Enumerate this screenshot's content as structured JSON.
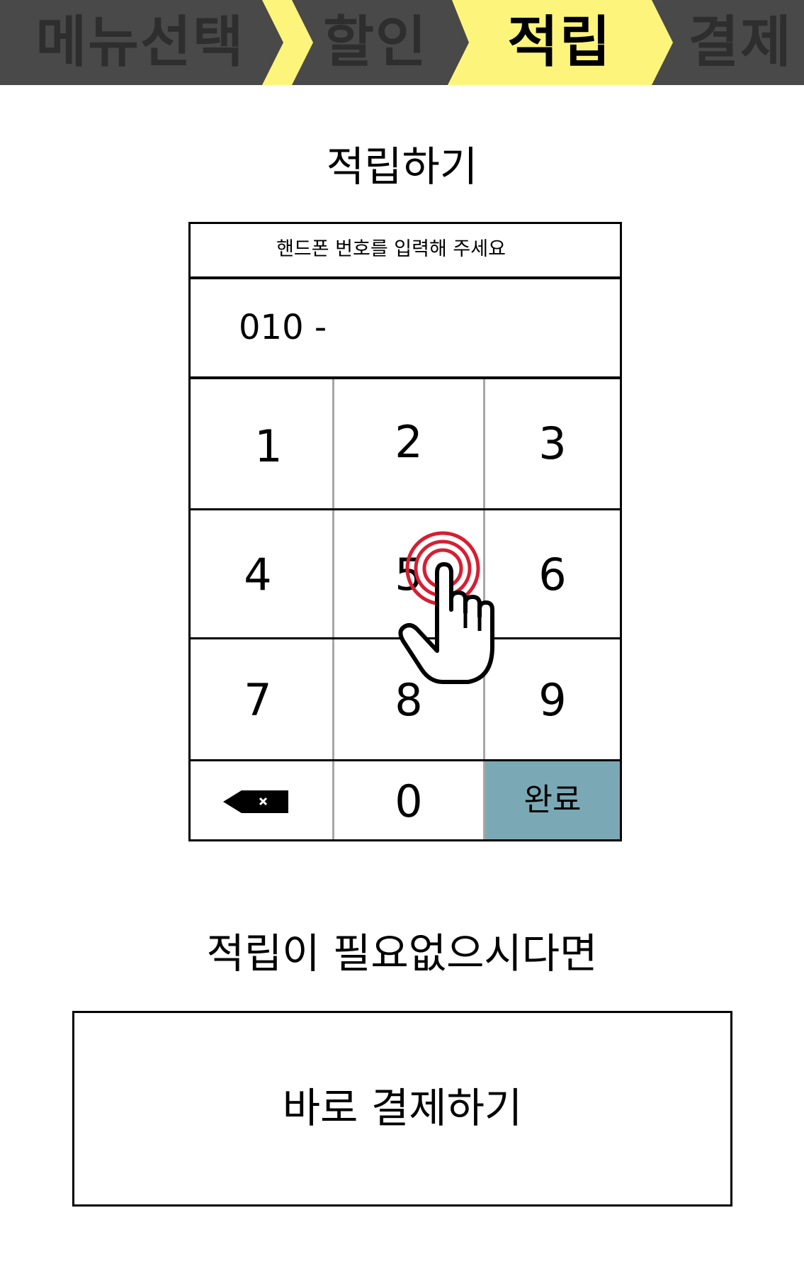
{
  "steps": {
    "menu": "메뉴선택",
    "discount": "할인",
    "points": "적립",
    "payment": "결제",
    "active": "points"
  },
  "colors": {
    "stepbar_bg": "#494949",
    "stepbar_active": "#fdf57b",
    "done_key_bg": "#7aa9b5",
    "touch_ring": "#d61f32"
  },
  "title": "적립하기",
  "keypad": {
    "instruction": "핸드폰 번호를 입력해 주세요",
    "input_value": "010 -",
    "keys": {
      "k1": "1",
      "k2": "2",
      "k3": "3",
      "k4": "4",
      "k5": "5",
      "k6": "6",
      "k7": "7",
      "k8": "8",
      "k9": "9",
      "k0": "0",
      "backspace_icon": "backspace-icon",
      "done": "완료"
    }
  },
  "skip": {
    "text": "적립이 필요없으시다면",
    "button": "바로 결제하기"
  },
  "overlay": {
    "icon": "pointing-hand-icon"
  }
}
